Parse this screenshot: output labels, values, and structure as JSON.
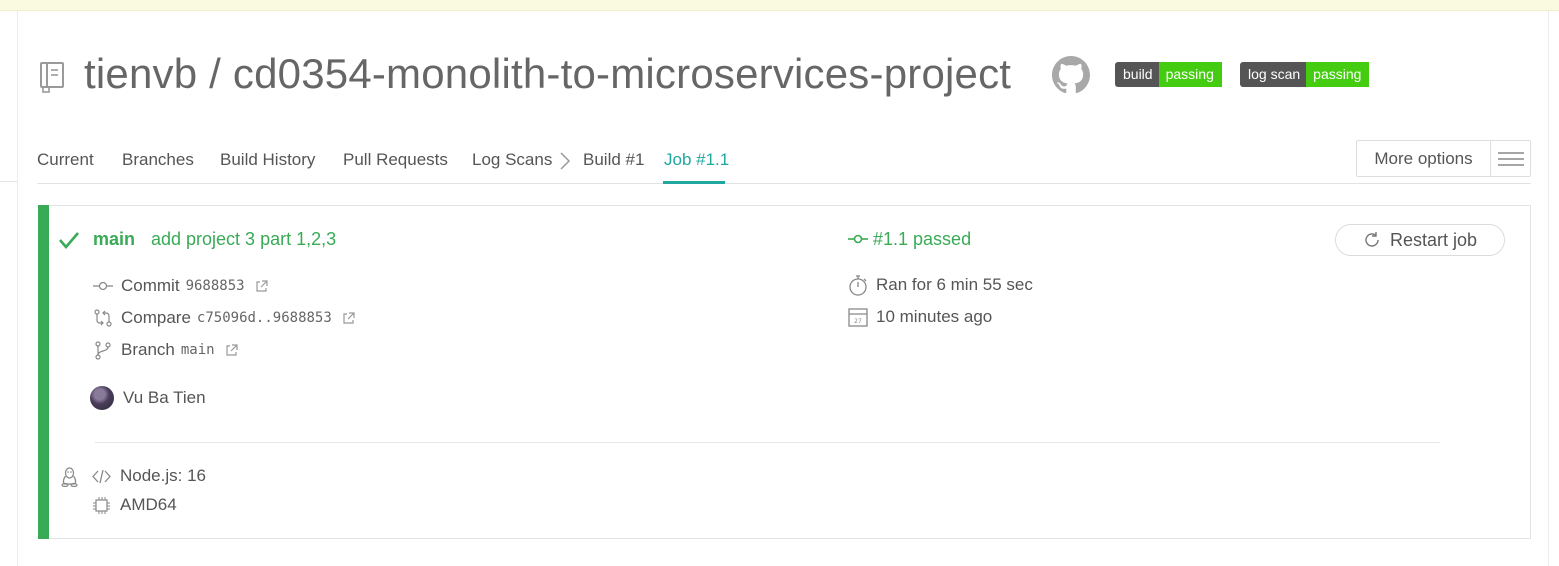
{
  "repo": {
    "title": "tienvb / cd0354-monolith-to-microservices-project"
  },
  "badges": {
    "build": {
      "key": "build",
      "value": "passing"
    },
    "log_scan": {
      "key": "log scan",
      "value": "passing"
    }
  },
  "tabs": [
    {
      "label": "Current"
    },
    {
      "label": "Branches"
    },
    {
      "label": "Build History"
    },
    {
      "label": "Pull Requests"
    },
    {
      "label": "Log Scans"
    },
    {
      "label": "Build #1"
    },
    {
      "label": "Job #1.1"
    }
  ],
  "more_options": {
    "label": "More options"
  },
  "job": {
    "branch": "main",
    "message": "add project 3 part 1,2,3",
    "commit_label": "Commit",
    "commit_sha": "9688853",
    "compare_label": "Compare",
    "compare_range": "c75096d..9688853",
    "branch_label": "Branch",
    "branch_value": "main",
    "author": "Vu Ba Tien",
    "status": "#1.1 passed",
    "duration": "Ran for 6 min 55 sec",
    "finished": "10 minutes ago",
    "restart_label": "Restart job",
    "language": "Node.js: 16",
    "arch": "AMD64"
  },
  "colors": {
    "success": "#39aa56",
    "accent": "#1fa7a0",
    "badge_key": "#555555",
    "badge_value": "#44cc11"
  },
  "icons": [
    "repo-icon",
    "github-icon",
    "chevron-right-icon",
    "menu-icon",
    "check-icon",
    "commit-icon",
    "compare-icon",
    "branch-icon",
    "external-link-icon",
    "stopwatch-icon",
    "calendar-icon",
    "restart-icon",
    "linux-icon",
    "code-icon",
    "cpu-icon"
  ]
}
